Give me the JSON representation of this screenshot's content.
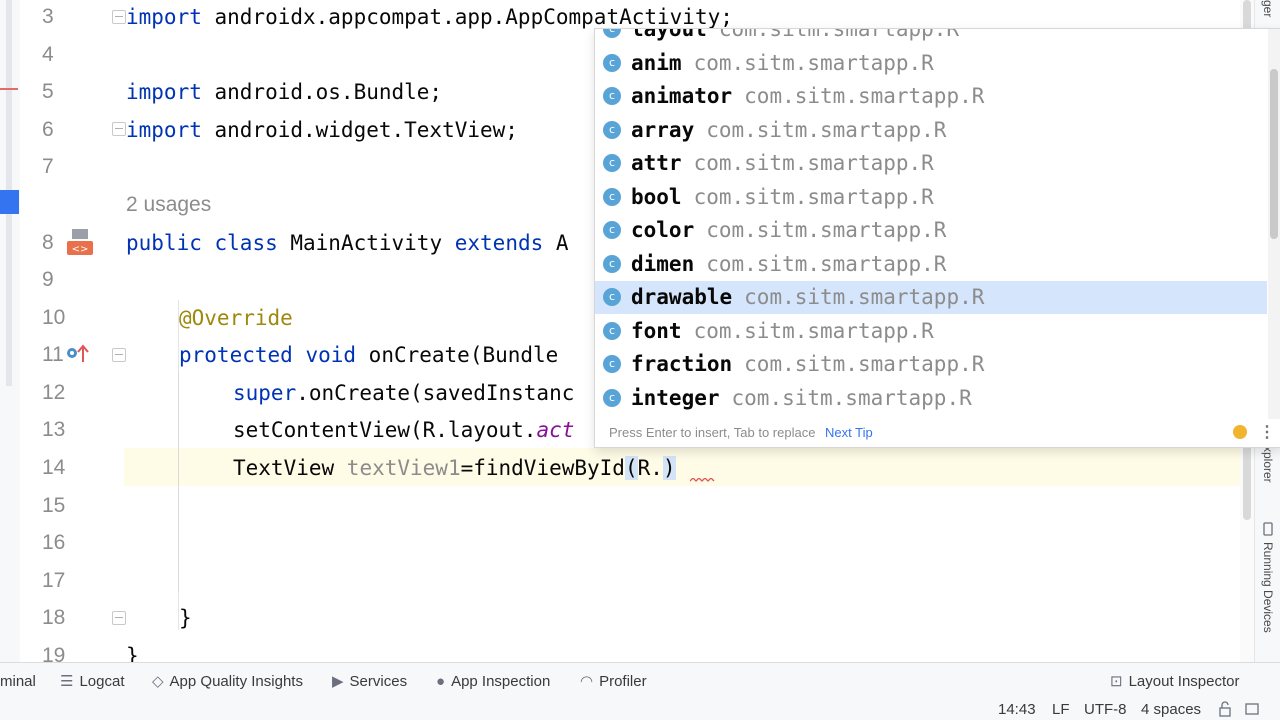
{
  "editor": {
    "line_numbers": [
      "3",
      "4",
      "5",
      "6",
      "7",
      "8",
      "9",
      "10",
      "11",
      "12",
      "13",
      "14",
      "15",
      "16",
      "17",
      "18",
      "19"
    ],
    "usages_hint": "2 usages",
    "lines": {
      "l3": {
        "kw": "import",
        "rest": " androidx.appcompat.app.AppCompatActivity;"
      },
      "l5": {
        "kw": "import",
        "rest": " android.os.Bundle;"
      },
      "l6": {
        "kw": "import",
        "rest": " android.widget.TextView;"
      },
      "l8": {
        "kw1": "public",
        "kw2": "class",
        "cls": " MainActivity ",
        "kw3": "extends",
        "rest": " A"
      },
      "l10": {
        "ann": "@Override"
      },
      "l11": {
        "kw1": "protected",
        "kw2": "void",
        "rest": " onCreate(Bundle "
      },
      "l12": {
        "kw": "super",
        "rest": ".onCreate(savedInstanc"
      },
      "l13": {
        "pre": "setContentView(R.layout.",
        "italic": "act"
      },
      "l14": {
        "type": "TextView ",
        "var": "textView1",
        "mid": "=findViewById",
        "paren": "(",
        "r": "R.",
        "close": ")"
      },
      "l18": {
        "text": "}"
      },
      "l19": {
        "text": "}"
      }
    }
  },
  "completion": {
    "items": [
      {
        "name": "layout",
        "pkg": "com.sitm.smartapp.R"
      },
      {
        "name": "anim",
        "pkg": "com.sitm.smartapp.R"
      },
      {
        "name": "animator",
        "pkg": "com.sitm.smartapp.R"
      },
      {
        "name": "array",
        "pkg": "com.sitm.smartapp.R"
      },
      {
        "name": "attr",
        "pkg": "com.sitm.smartapp.R"
      },
      {
        "name": "bool",
        "pkg": "com.sitm.smartapp.R"
      },
      {
        "name": "color",
        "pkg": "com.sitm.smartapp.R"
      },
      {
        "name": "dimen",
        "pkg": "com.sitm.smartapp.R"
      },
      {
        "name": "drawable",
        "pkg": "com.sitm.smartapp.R"
      },
      {
        "name": "font",
        "pkg": "com.sitm.smartapp.R"
      },
      {
        "name": "fraction",
        "pkg": "com.sitm.smartapp.R"
      },
      {
        "name": "integer",
        "pkg": "com.sitm.smartapp.R"
      }
    ],
    "selected_item": "drawable",
    "class_icon_letter": "c",
    "footer_tip": "Press Enter to insert, Tab to replace",
    "next_tip": "Next Tip",
    "more_icon": "⋮"
  },
  "side_panels": {
    "right_top": "ger",
    "right_mid": "xplorer",
    "running_devices": "Running Devices"
  },
  "tool_windows": {
    "terminal": "minal",
    "logcat": "Logcat",
    "app_quality": "App Quality Insights",
    "services": "Services",
    "app_inspection": "App Inspection",
    "profiler": "Profiler",
    "layout_inspector": "Layout Inspector"
  },
  "status": {
    "position": "14:43",
    "line_sep": "LF",
    "encoding": "UTF-8",
    "indent": "4 spaces"
  },
  "colors": {
    "keyword": "#0033b3",
    "annotation": "#9e880d",
    "selected_row": "#d5e5fb",
    "current_line": "#fefbe6"
  }
}
